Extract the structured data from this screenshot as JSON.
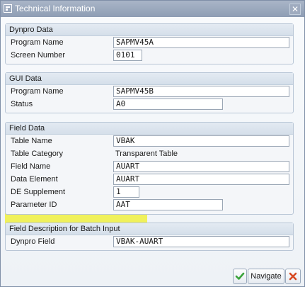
{
  "window": {
    "title": "Technical Information",
    "close_icon": "close-icon"
  },
  "groups": {
    "dynpro": {
      "header": "Dynpro Data",
      "rows": [
        {
          "label": "Program Name",
          "value": "SAPMV45A"
        },
        {
          "label": "Screen Number",
          "value": "0101"
        }
      ]
    },
    "gui": {
      "header": "GUI Data",
      "rows": [
        {
          "label": "Program Name",
          "value": "SAPMV45B"
        },
        {
          "label": "Status",
          "value": "A0"
        }
      ]
    },
    "field": {
      "header": "Field Data",
      "rows": [
        {
          "label": "Table Name",
          "value": "VBAK"
        },
        {
          "label": "Table Category",
          "value": "Transparent Table"
        },
        {
          "label": "Field Name",
          "value": "AUART"
        },
        {
          "label": "Data Element",
          "value": "AUART"
        },
        {
          "label": "DE Supplement",
          "value": "1"
        },
        {
          "label": "Parameter ID",
          "value": "AAT"
        }
      ]
    },
    "batch": {
      "header": "Field Description for Batch Input",
      "rows": [
        {
          "label": "Dynpro Field",
          "value": "VBAK-AUART"
        }
      ]
    }
  },
  "highlight_color": "#f0f040",
  "buttons": {
    "confirm_icon": "checkmark-icon",
    "navigate_label": "Navigate",
    "cancel_icon": "cancel-x-icon"
  }
}
